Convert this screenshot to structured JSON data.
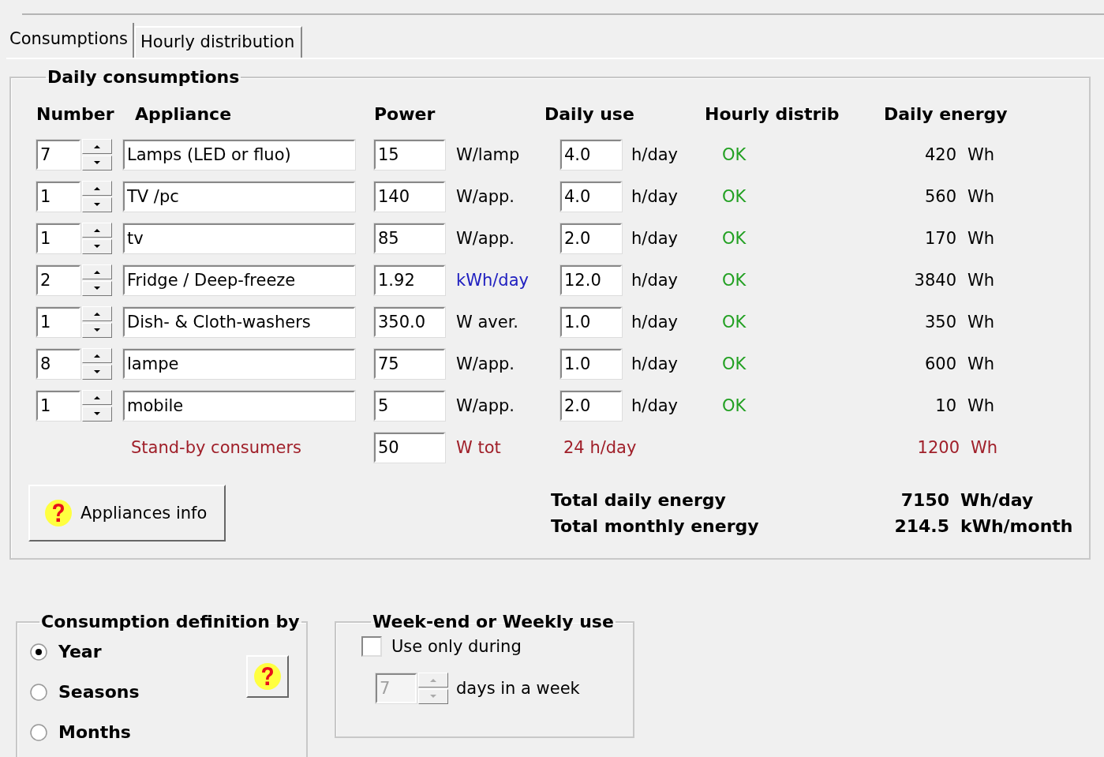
{
  "tabs": [
    {
      "label": "Consumptions",
      "selected": true
    },
    {
      "label": "Hourly distribution",
      "selected": false
    }
  ],
  "daily_consumptions": {
    "title": "Daily consumptions",
    "columns": [
      "Number",
      "Appliance",
      "Power",
      "Daily use",
      "Hourly distrib",
      "Daily energy"
    ],
    "rows": [
      {
        "number": "7",
        "appliance": "Lamps (LED or fluo)",
        "power": "15",
        "power_unit": "W/lamp",
        "unit_highlighted": false,
        "daily_use": "4.0",
        "use_unit": "h/day",
        "hourly_distrib": "OK",
        "energy": "420",
        "energy_unit": "Wh"
      },
      {
        "number": "1",
        "appliance": "TV /pc",
        "power": "140",
        "power_unit": "W/app.",
        "unit_highlighted": false,
        "daily_use": "4.0",
        "use_unit": "h/day",
        "hourly_distrib": "OK",
        "energy": "560",
        "energy_unit": "Wh"
      },
      {
        "number": "1",
        "appliance": "tv",
        "power": "85",
        "power_unit": "W/app.",
        "unit_highlighted": false,
        "daily_use": "2.0",
        "use_unit": "h/day",
        "hourly_distrib": "OK",
        "energy": "170",
        "energy_unit": "Wh"
      },
      {
        "number": "2",
        "appliance": "Fridge / Deep-freeze",
        "power": "1.92",
        "power_unit": "kWh/day",
        "unit_highlighted": true,
        "daily_use": "12.0",
        "use_unit": "h/day",
        "hourly_distrib": "OK",
        "energy": "3840",
        "energy_unit": "Wh"
      },
      {
        "number": "1",
        "appliance": "Dish- & Cloth-washers",
        "power": "350.0",
        "power_unit": "W aver.",
        "unit_highlighted": false,
        "daily_use": "1.0",
        "use_unit": "h/day",
        "hourly_distrib": "OK",
        "energy": "350",
        "energy_unit": "Wh"
      },
      {
        "number": "8",
        "appliance": "lampe",
        "power": "75",
        "power_unit": "W/app.",
        "unit_highlighted": false,
        "daily_use": "1.0",
        "use_unit": "h/day",
        "hourly_distrib": "OK",
        "energy": "600",
        "energy_unit": "Wh"
      },
      {
        "number": "1",
        "appliance": "mobile",
        "power": "5",
        "power_unit": "W/app.",
        "unit_highlighted": false,
        "daily_use": "2.0",
        "use_unit": "h/day",
        "hourly_distrib": "OK",
        "energy": "10",
        "energy_unit": "Wh"
      }
    ],
    "standby": {
      "label": "Stand-by consumers",
      "power": "50",
      "power_unit": "W tot",
      "daily_use": "24 h/day",
      "energy": "1200",
      "energy_unit": "Wh"
    },
    "info_button": "Appliances info",
    "totals": [
      {
        "label": "Total daily energy",
        "value": "7150",
        "unit": "Wh/day"
      },
      {
        "label": "Total monthly energy",
        "value": "214.5",
        "unit": "kWh/month"
      }
    ]
  },
  "consumption_definition": {
    "title": "Consumption definition by",
    "options": [
      {
        "label": "Year",
        "selected": true
      },
      {
        "label": "Seasons",
        "selected": false
      },
      {
        "label": "Months",
        "selected": false
      }
    ]
  },
  "weekly_use": {
    "title": "Week-end or Weekly use",
    "checkbox": {
      "label": "Use only during",
      "checked": false
    },
    "days": {
      "value": "7",
      "disabled": true
    },
    "days_label": "days in a week"
  }
}
